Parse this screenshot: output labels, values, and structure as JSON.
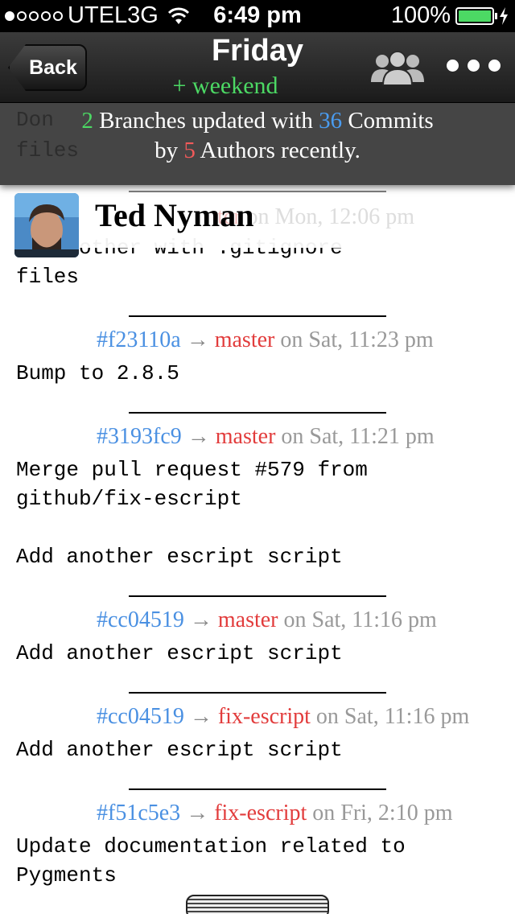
{
  "status": {
    "carrier": "UTEL3G",
    "time": "6:49 pm",
    "battery": "100%",
    "signal_bars_filled": 1,
    "signal_bars_total": 5,
    "battery_level": 1.0
  },
  "nav": {
    "back_label": "Back",
    "title": "Friday",
    "subtitle": "+ weekend",
    "people_icon": "people-group-icon",
    "more_icon": "more-dots-icon"
  },
  "summary": {
    "branches": "2",
    "text1": " Branches updated with ",
    "commits": "36",
    "text2": " Commits",
    "text3": "by ",
    "authors": "5",
    "text4": " Authors recently."
  },
  "ghost": {
    "line1": "Don",
    "line2": "files"
  },
  "author": {
    "name": "Ted Nyman",
    "faded_branch": "ter",
    "faded_time": " on Mon, 12:06 pm"
  },
  "partial_commit": {
    "line1": "  t bother with .gitignore",
    "line2": "files"
  },
  "commits": [
    {
      "sha": "#f23110a",
      "arrow": "→",
      "branch": "master",
      "when": " on Sat, 11:23 pm",
      "message": "Bump to 2.8.5"
    },
    {
      "sha": "#3193fc9",
      "arrow": "→",
      "branch": "master",
      "when": " on Sat, 11:21 pm",
      "message": "Merge pull request #579 from\ngithub/fix-escript\n\nAdd another escript script"
    },
    {
      "sha": "#cc04519",
      "arrow": "→",
      "branch": "master",
      "when": " on Sat, 11:16 pm",
      "message": "Add another escript script"
    },
    {
      "sha": "#cc04519",
      "arrow": "→",
      "branch": "fix-escript",
      "when": " on Sat, 11:16 pm",
      "message": "Add another escript script"
    },
    {
      "sha": "#f51c5e3",
      "arrow": "→",
      "branch": "fix-escript",
      "when": " on Fri, 2:10 pm",
      "message": "Update documentation related to\nPygments"
    }
  ]
}
